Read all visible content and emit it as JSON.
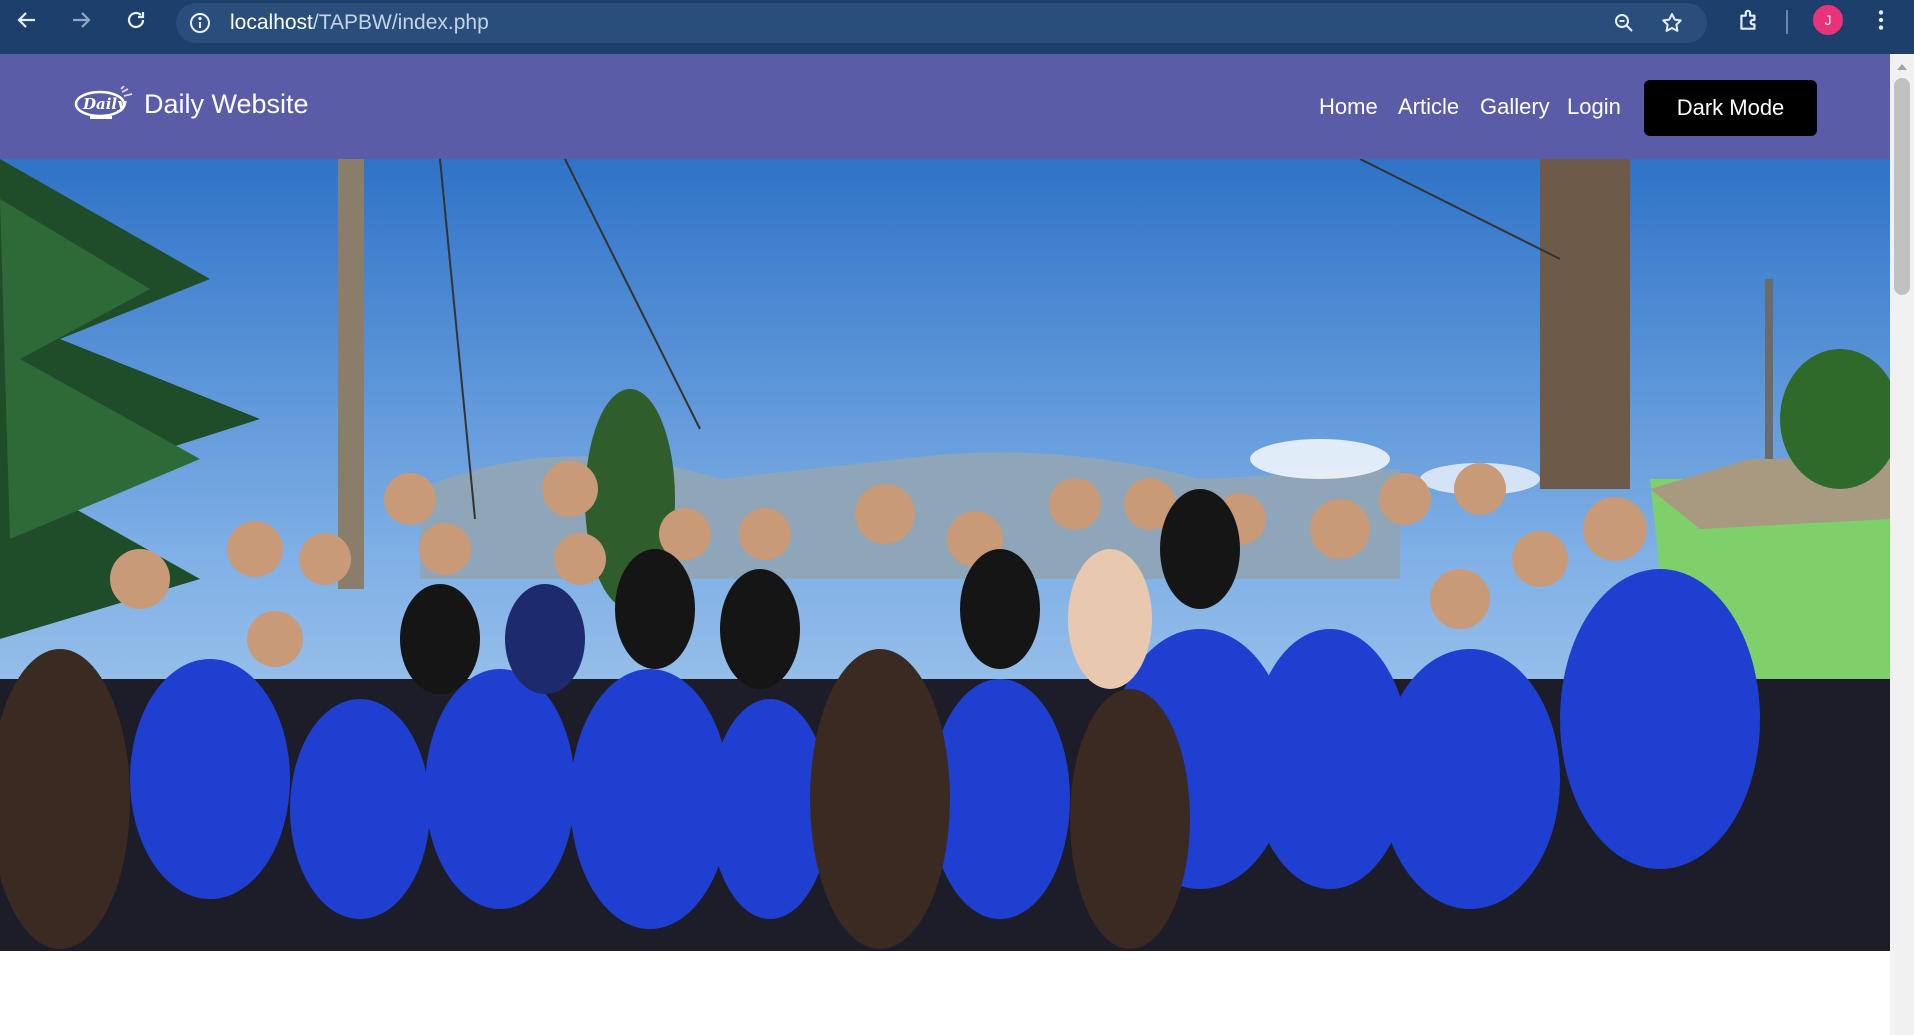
{
  "browser": {
    "url_host": "localhost",
    "url_path": "/TAPBW/index.php",
    "profile_initial": "J",
    "icons": [
      "back-icon",
      "forward-icon",
      "reload-icon",
      "site-info-icon",
      "zoom-icon",
      "bookmark-star-icon",
      "extensions-icon",
      "more-menu-icon"
    ]
  },
  "site": {
    "brand": "Daily Website",
    "brand_color": "#5a5ca8",
    "menu": [
      {
        "label": "Home"
      },
      {
        "label": "Article"
      },
      {
        "label": "Gallery"
      },
      {
        "label": "Login"
      }
    ],
    "dark_mode_label": "Dark Mode"
  },
  "hero": {
    "image": "group-photo"
  }
}
